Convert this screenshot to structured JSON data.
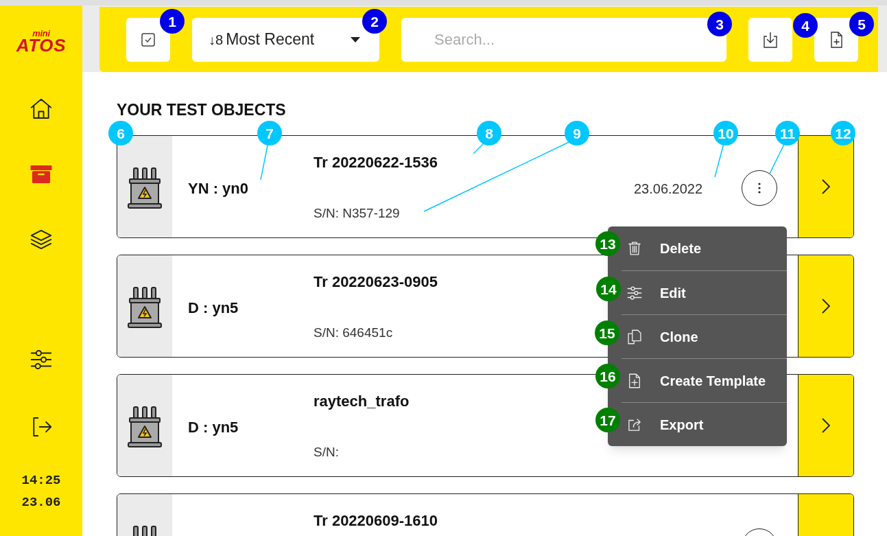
{
  "logo": {
    "top": "mini",
    "bottom": "ATOS"
  },
  "sidebar": {
    "items": [
      {
        "kind": "home",
        "selected": false
      },
      {
        "kind": "archive",
        "selected": true
      },
      {
        "kind": "layers",
        "selected": false
      },
      {
        "kind": "settings",
        "selected": false
      },
      {
        "kind": "logout",
        "selected": false
      }
    ],
    "time": "14:25",
    "date": "23.06"
  },
  "toolbar": {
    "sort": {
      "icon": "↓8",
      "label": "Most Recent"
    },
    "search": {
      "placeholder": "Search..."
    }
  },
  "section_title": "YOUR TEST OBJECTS",
  "objects": [
    {
      "vector_group": "YN : yn0",
      "name": "Tr 20220622-1536",
      "serial": "S/N: N357-129",
      "date": "23.06.2022"
    },
    {
      "vector_group": "D : yn5",
      "name": "Tr 20220623-0905",
      "serial": "S/N: 646451c"
    },
    {
      "vector_group": "D : yn5",
      "name": "raytech_trafo",
      "serial": "S/N:"
    },
    {
      "name": "Tr 20220609-1610"
    }
  ],
  "context_menu": [
    {
      "kind": "delete",
      "label": "Delete"
    },
    {
      "kind": "edit",
      "label": "Edit"
    },
    {
      "kind": "clone",
      "label": "Clone"
    },
    {
      "kind": "template",
      "label": "Create Template"
    },
    {
      "kind": "export",
      "label": "Export"
    }
  ],
  "callouts": [
    {
      "number": "1",
      "color": "#0000e6"
    },
    {
      "number": "2",
      "color": "#0000e6"
    },
    {
      "number": "3",
      "color": "#0000e6"
    },
    {
      "number": "4",
      "color": "#0000e6"
    },
    {
      "number": "5",
      "color": "#0000e6"
    },
    {
      "number": "6",
      "color": "#00c8ff"
    },
    {
      "number": "7",
      "color": "#00c8ff"
    },
    {
      "number": "8",
      "color": "#00c8ff"
    },
    {
      "number": "9",
      "color": "#00c8ff"
    },
    {
      "number": "10",
      "color": "#00c8ff"
    },
    {
      "number": "11",
      "color": "#00c8ff"
    },
    {
      "number": "12",
      "color": "#00c8ff"
    },
    {
      "number": "13",
      "color": "#008000"
    },
    {
      "number": "14",
      "color": "#008000"
    },
    {
      "number": "15",
      "color": "#008000"
    },
    {
      "number": "16",
      "color": "#008000"
    },
    {
      "number": "17",
      "color": "#008000"
    }
  ]
}
